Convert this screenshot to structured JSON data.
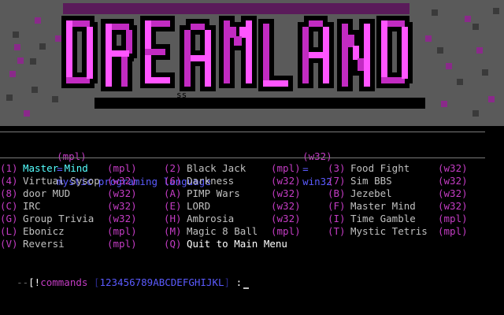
{
  "banner": {
    "title": "DREAMLAND",
    "tag": "ss",
    "colors": {
      "bg": "#5a5a5a",
      "outline": "#000000",
      "fill": "#c22bc2",
      "fill_light": "#ff55ff",
      "block": "#5a1b5a"
    }
  },
  "legend": {
    "mpl_key": "(mpl)",
    "mpl_eq": "=",
    "mpl_desc": "mystic programing language",
    "w32_key": "(w32)",
    "w32_eq": "=",
    "w32_desc": "win32"
  },
  "menu": [
    {
      "key": "(1)",
      "name": "Master Mind",
      "lang": "(mpl)",
      "selected": true
    },
    {
      "key": "(4)",
      "name": "Virtual Sysop",
      "lang": "(w32)"
    },
    {
      "key": "(8)",
      "name": "door MUD",
      "lang": "(w32)"
    },
    {
      "key": "(C)",
      "name": "IRC",
      "lang": "(w32)"
    },
    {
      "key": "(G)",
      "name": "Group Trivia",
      "lang": "(w32)"
    },
    {
      "key": "(L)",
      "name": "Ebonicz",
      "lang": "(mpl)"
    },
    {
      "key": "(V)",
      "name": "Reversi",
      "lang": "(mpl)"
    },
    {
      "key": "(2)",
      "name": "Black Jack",
      "lang": "(mpl)"
    },
    {
      "key": "(6)",
      "name": "Darkness",
      "lang": "(w32)"
    },
    {
      "key": "(A)",
      "name": "PIMP Wars",
      "lang": "(w32)"
    },
    {
      "key": "(E)",
      "name": "LORD",
      "lang": "(w32)"
    },
    {
      "key": "(H)",
      "name": "Ambrosia",
      "lang": "(w32)"
    },
    {
      "key": "(M)",
      "name": "Magic 8 Ball",
      "lang": "(mpl)"
    },
    {
      "key": "(Q)",
      "name": "Quit to Main Menu",
      "lang": ""
    },
    {
      "key": "(3)",
      "name": "Food Fight",
      "lang": "(w32)"
    },
    {
      "key": "(7)",
      "name": "Sim BBS",
      "lang": "(w32)"
    },
    {
      "key": "(B)",
      "name": "Jezebel",
      "lang": "(w32)"
    },
    {
      "key": "(F)",
      "name": "Master Mind",
      "lang": "(w32)"
    },
    {
      "key": "(I)",
      "name": "Time Gamble",
      "lang": "(mpl)"
    },
    {
      "key": "(T)",
      "name": "Mystic Tetris",
      "lang": "(mpl)"
    }
  ],
  "prompt": {
    "dashes": "--",
    "open": "[",
    "bang": "!",
    "label": "commands",
    "keys": "123456789ABCDEFGHIJKL",
    "close": "]",
    "colon": ":"
  }
}
